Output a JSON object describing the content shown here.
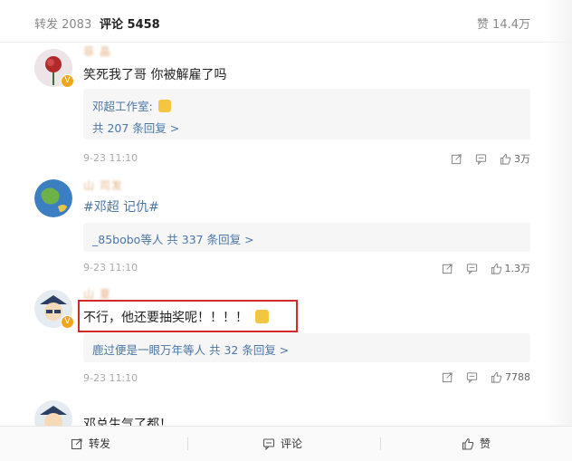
{
  "tabs": {
    "repost": "转发 2083",
    "comment": "评论 5458",
    "like": "赞 14.4万"
  },
  "comments": [
    {
      "username": "菲 晶",
      "text": "笑死我了哥 你被解雇了吗",
      "reply_line_1": "邓超工作室:",
      "reply_line_2": "共 207 条回复 >",
      "time": "9-23 11:10",
      "likes": "3万"
    },
    {
      "username": "山 司发",
      "text_tag": "#邓超 记仇#",
      "reply_line_1": "_85bobo等人  共 337 条回复 >",
      "time": "9-23 11:10",
      "likes": "1.3万"
    },
    {
      "username": "山 夏",
      "text": "不行，他还要抽奖呢！！！！",
      "reply_line_1": "鹿过便是一眼万年等人  共 32 条回复 >",
      "time": "9-23 11:10",
      "likes": "7788"
    },
    {
      "username": "",
      "text": "邓总生气了都！"
    }
  ],
  "bottom_bar": {
    "repost": "转发",
    "comment": "评论",
    "like": "赞"
  },
  "colors": {
    "link": "#4a76a8",
    "highlight": "#d12a2a",
    "badge": "#f0a51c"
  }
}
